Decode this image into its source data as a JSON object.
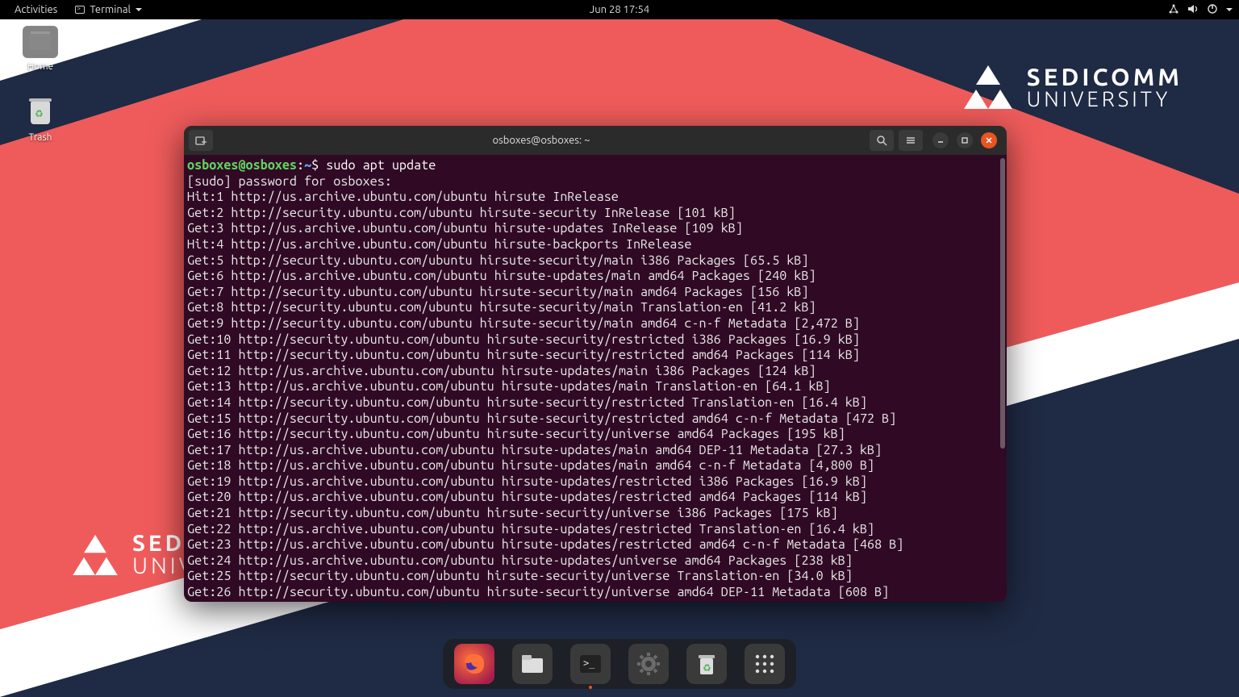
{
  "topbar": {
    "activities": "Activities",
    "app_name": "Terminal",
    "clock": "Jun 28  17:54"
  },
  "desktop": {
    "home_label": "Home",
    "trash_label": "Trash"
  },
  "brand": {
    "line1": "SEDICOMM",
    "line2": "UNIVERSITY"
  },
  "terminal": {
    "title": "osboxes@osboxes: ~",
    "prompt_user": "osboxes@osboxes",
    "prompt_sep": ":",
    "prompt_path": "~",
    "prompt_dlr": "$ ",
    "command": "sudo apt update",
    "lines": [
      "[sudo] password for osboxes:",
      "Hit:1 http://us.archive.ubuntu.com/ubuntu hirsute InRelease",
      "Get:2 http://security.ubuntu.com/ubuntu hirsute-security InRelease [101 kB]",
      "Get:3 http://us.archive.ubuntu.com/ubuntu hirsute-updates InRelease [109 kB]",
      "Hit:4 http://us.archive.ubuntu.com/ubuntu hirsute-backports InRelease",
      "Get:5 http://security.ubuntu.com/ubuntu hirsute-security/main i386 Packages [65.5 kB]",
      "Get:6 http://us.archive.ubuntu.com/ubuntu hirsute-updates/main amd64 Packages [240 kB]",
      "Get:7 http://security.ubuntu.com/ubuntu hirsute-security/main amd64 Packages [156 kB]",
      "Get:8 http://security.ubuntu.com/ubuntu hirsute-security/main Translation-en [41.2 kB]",
      "Get:9 http://security.ubuntu.com/ubuntu hirsute-security/main amd64 c-n-f Metadata [2,472 B]",
      "Get:10 http://security.ubuntu.com/ubuntu hirsute-security/restricted i386 Packages [16.9 kB]",
      "Get:11 http://security.ubuntu.com/ubuntu hirsute-security/restricted amd64 Packages [114 kB]",
      "Get:12 http://us.archive.ubuntu.com/ubuntu hirsute-updates/main i386 Packages [124 kB]",
      "Get:13 http://us.archive.ubuntu.com/ubuntu hirsute-updates/main Translation-en [64.1 kB]",
      "Get:14 http://security.ubuntu.com/ubuntu hirsute-security/restricted Translation-en [16.4 kB]",
      "Get:15 http://security.ubuntu.com/ubuntu hirsute-security/restricted amd64 c-n-f Metadata [472 B]",
      "Get:16 http://security.ubuntu.com/ubuntu hirsute-security/universe amd64 Packages [195 kB]",
      "Get:17 http://us.archive.ubuntu.com/ubuntu hirsute-updates/main amd64 DEP-11 Metadata [27.3 kB]",
      "Get:18 http://us.archive.ubuntu.com/ubuntu hirsute-updates/main amd64 c-n-f Metadata [4,800 B]",
      "Get:19 http://us.archive.ubuntu.com/ubuntu hirsute-updates/restricted i386 Packages [16.9 kB]",
      "Get:20 http://us.archive.ubuntu.com/ubuntu hirsute-updates/restricted amd64 Packages [114 kB]",
      "Get:21 http://security.ubuntu.com/ubuntu hirsute-security/universe i386 Packages [175 kB]",
      "Get:22 http://us.archive.ubuntu.com/ubuntu hirsute-updates/restricted Translation-en [16.4 kB]",
      "Get:23 http://us.archive.ubuntu.com/ubuntu hirsute-updates/restricted amd64 c-n-f Metadata [468 B]",
      "Get:24 http://us.archive.ubuntu.com/ubuntu hirsute-updates/universe amd64 Packages [238 kB]",
      "Get:25 http://security.ubuntu.com/ubuntu hirsute-security/universe Translation-en [34.0 kB]",
      "Get:26 http://security.ubuntu.com/ubuntu hirsute-security/universe amd64 DEP-11 Metadata [608 B]"
    ]
  },
  "dock": {
    "items": [
      "firefox",
      "files",
      "terminal",
      "settings",
      "trash",
      "apps"
    ]
  }
}
